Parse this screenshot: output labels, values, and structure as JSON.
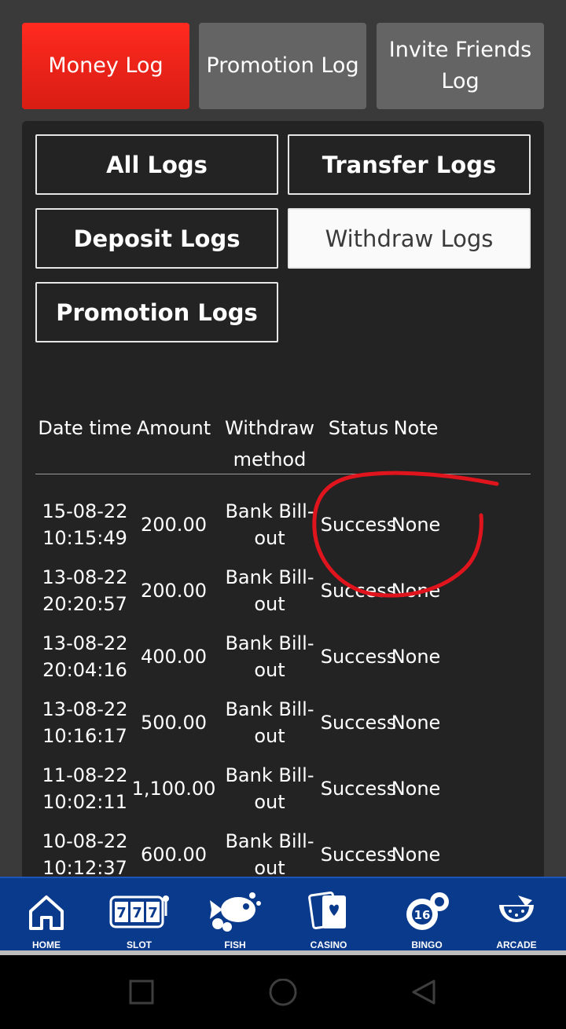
{
  "top_tabs": [
    {
      "label": "Money Log",
      "active": true
    },
    {
      "label": "Promotion Log",
      "active": false
    },
    {
      "label": "Invite Friends Log",
      "active": false
    }
  ],
  "filters": {
    "all": "All Logs",
    "transfer": "Transfer Logs",
    "deposit": "Deposit Logs",
    "withdraw": "Withdraw Logs",
    "promotion": "Promotion Logs",
    "active": "withdraw"
  },
  "table": {
    "headers": {
      "date": "Date time",
      "amount": "Amount",
      "method": "Withdraw method",
      "status": "Status",
      "note": "Note"
    },
    "rows": [
      {
        "date": "15-08-22 10:15:49",
        "amount": "200.00",
        "method": "Bank Bill-out",
        "status": "Success",
        "note": "None"
      },
      {
        "date": "13-08-22 20:20:57",
        "amount": "200.00",
        "method": "Bank Bill-out",
        "status": "Success",
        "note": "None"
      },
      {
        "date": "13-08-22 20:04:16",
        "amount": "400.00",
        "method": "Bank Bill-out",
        "status": "Success",
        "note": "None"
      },
      {
        "date": "13-08-22 10:16:17",
        "amount": "500.00",
        "method": "Bank Bill-out",
        "status": "Success",
        "note": "None"
      },
      {
        "date": "11-08-22 10:02:11",
        "amount": "1,100.00",
        "method": "Bank Bill-out",
        "status": "Success",
        "note": "None"
      },
      {
        "date": "10-08-22 10:12:37",
        "amount": "600.00",
        "method": "Bank Bill-out",
        "status": "Success",
        "note": "None"
      }
    ]
  },
  "bottom_nav": [
    {
      "label": "HOME",
      "icon": "home-icon"
    },
    {
      "label": "SLOT",
      "icon": "slot-machine-icon"
    },
    {
      "label": "FISH",
      "icon": "fish-icon"
    },
    {
      "label": "CASINO",
      "icon": "playing-cards-icon"
    },
    {
      "label": "BINGO",
      "icon": "bingo-ball-icon"
    },
    {
      "label": "ARCADE",
      "icon": "watermelon-icon"
    }
  ],
  "colors": {
    "accent_red": "#e8231a",
    "nav_blue": "#0a3a8c",
    "annotation_red": "#e0141c"
  }
}
